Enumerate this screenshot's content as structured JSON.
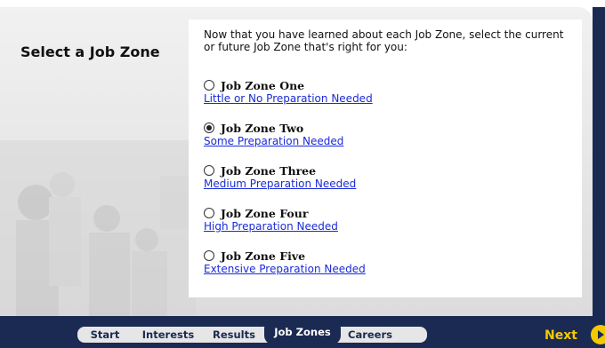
{
  "heading": "Select a Job Zone",
  "instructions": "Now that you have learned about each Job Zone, select the current or future Job Zone that's right for you:",
  "options": [
    {
      "title": "Job Zone One",
      "link": "Little or No Preparation Needed",
      "selected": false
    },
    {
      "title": "Job Zone Two",
      "link": "Some Preparation Needed",
      "selected": true
    },
    {
      "title": "Job Zone Three",
      "link": "Medium Preparation Needed",
      "selected": false
    },
    {
      "title": "Job Zone Four",
      "link": "High Preparation Needed",
      "selected": false
    },
    {
      "title": "Job Zone Five",
      "link": "Extensive Preparation Needed",
      "selected": false
    }
  ],
  "nav": {
    "tabs": [
      "Start",
      "Interests",
      "Results",
      "Job Zones",
      "Careers"
    ],
    "active_tab": "Job Zones",
    "next_label": "Next"
  },
  "colors": {
    "navy": "#1a2a52",
    "accent_yellow": "#f6c800",
    "link_blue": "#1a2bd6"
  }
}
